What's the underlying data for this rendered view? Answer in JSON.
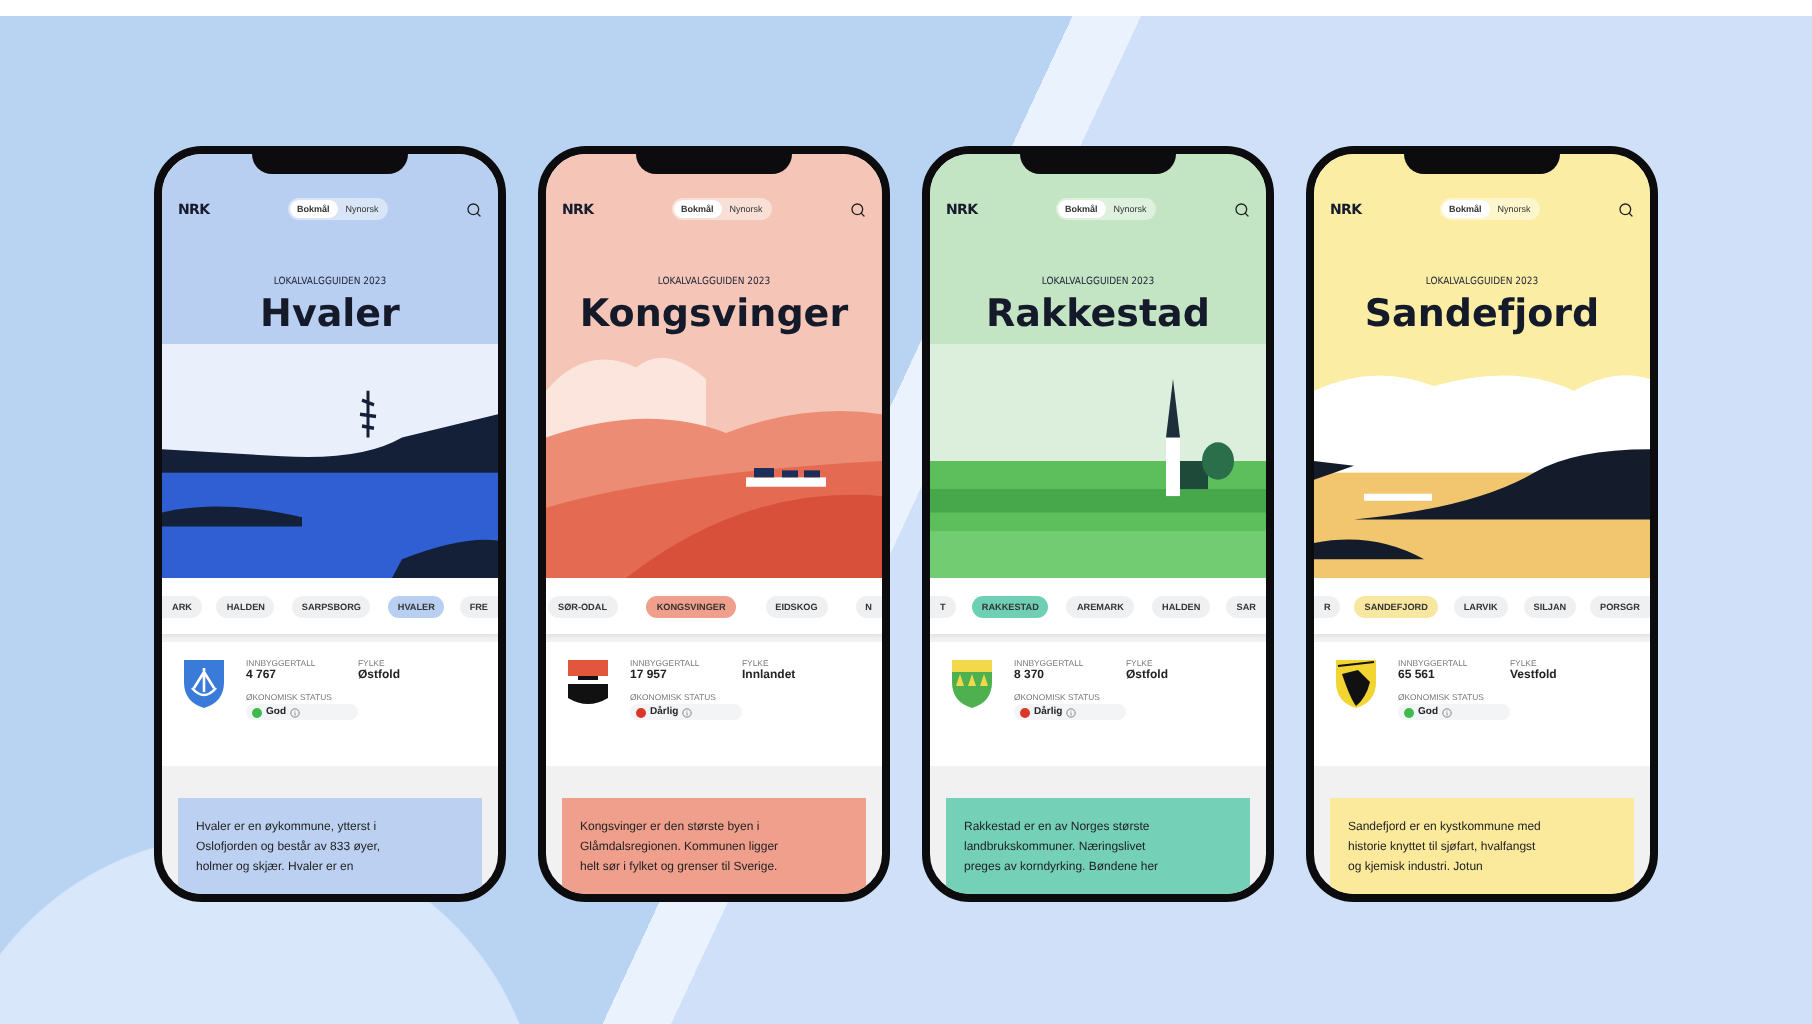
{
  "phones": [
    {
      "kind": "sea",
      "logo": "NRK",
      "languages": [
        {
          "label": "Bokmål",
          "selected": true
        },
        {
          "label": "Nynorsk",
          "selected": false
        }
      ],
      "kicker": "LOKALVALGGUIDEN 2023",
      "title": "Hvaler",
      "chips": [
        {
          "label": "ARK",
          "selected": false,
          "kind": "cutleft"
        },
        {
          "label": "HALDEN",
          "selected": false,
          "kind": "whole"
        },
        {
          "label": "SARPSBORG",
          "selected": false,
          "kind": "whole"
        },
        {
          "label": "HVALER",
          "selected": true,
          "kind": "whole"
        },
        {
          "label": "FRE",
          "selected": false,
          "kind": "cutright"
        }
      ],
      "stats": {
        "population_label": "INNBYGGERTALL",
        "population": "4 767",
        "county_label": "FYLKE",
        "county": "Østfold",
        "status_label": "ØKONOMISK STATUS",
        "status": {
          "label": "God",
          "color": "#3dbb4f"
        }
      },
      "description": "Hvaler er en øykommune, ytterst i\nOslofjorden og består av 833 øyer,\nholmer og skjær. Hvaler er en"
    },
    {
      "kind": "hills",
      "logo": "NRK",
      "languages": [
        {
          "label": "Bokmål",
          "selected": true
        },
        {
          "label": "Nynorsk",
          "selected": false
        }
      ],
      "kicker": "LOKALVALGGUIDEN 2023",
      "title": "Kongsvinger",
      "chips": [
        {
          "label": "SØR-ODAL",
          "selected": false,
          "kind": "whole"
        },
        {
          "label": "KONGSVINGER",
          "selected": true,
          "kind": "whole"
        },
        {
          "label": "EIDSKOG",
          "selected": false,
          "kind": "whole"
        },
        {
          "label": "N",
          "selected": false,
          "kind": "cutright"
        }
      ],
      "stats": {
        "population_label": "INNBYGGERTALL",
        "population": "17 957",
        "county_label": "FYLKE",
        "county": "Innlandet",
        "status_label": "ØKONOMISK STATUS",
        "status": {
          "label": "Dårlig",
          "color": "#d9382b"
        }
      },
      "description": "Kongsvinger er den største byen i\nGlåmdalsregionen. Kommunen ligger\nhelt sør i fylket og grenser til Sverige."
    },
    {
      "kind": "fields",
      "logo": "NRK",
      "languages": [
        {
          "label": "Bokmål",
          "selected": true
        },
        {
          "label": "Nynorsk",
          "selected": false
        }
      ],
      "kicker": "LOKALVALGGUIDEN 2023",
      "title": "Rakkestad",
      "chips": [
        {
          "label": "T",
          "selected": false,
          "kind": "cutleft"
        },
        {
          "label": "RAKKESTAD",
          "selected": true,
          "kind": "whole"
        },
        {
          "label": "AREMARK",
          "selected": false,
          "kind": "whole"
        },
        {
          "label": "HALDEN",
          "selected": false,
          "kind": "whole"
        },
        {
          "label": "SAR",
          "selected": false,
          "kind": "cutright"
        }
      ],
      "stats": {
        "population_label": "INNBYGGERTALL",
        "population": "8 370",
        "county_label": "FYLKE",
        "county": "Østfold",
        "status_label": "ØKONOMISK STATUS",
        "status": {
          "label": "Dårlig",
          "color": "#d9382b"
        }
      },
      "description": "Rakkestad er en av Norges største\nlandbrukskommuner. Næringslivet\npreges av korndyrking. Bøndene her"
    },
    {
      "kind": "coast",
      "logo": "NRK",
      "languages": [
        {
          "label": "Bokmål",
          "selected": true
        },
        {
          "label": "Nynorsk",
          "selected": false
        }
      ],
      "kicker": "LOKALVALGGUIDEN 2023",
      "title": "Sandefjord",
      "chips": [
        {
          "label": "R",
          "selected": false,
          "kind": "cutleft"
        },
        {
          "label": "SANDEFJORD",
          "selected": true,
          "kind": "whole"
        },
        {
          "label": "LARVIK",
          "selected": false,
          "kind": "whole"
        },
        {
          "label": "SILJAN",
          "selected": false,
          "kind": "whole"
        },
        {
          "label": "PORSGR",
          "selected": false,
          "kind": "cutright"
        }
      ],
      "stats": {
        "population_label": "INNBYGGERTALL",
        "population": "65 561",
        "county_label": "FYLKE",
        "county": "Vestfold",
        "status_label": "ØKONOMISK STATUS",
        "status": {
          "label": "God",
          "color": "#3dbb4f"
        }
      },
      "description": "Sandefjord er en kystkommune med\nhistorie knyttet til sjøfart, hvalfangst\nog kjemisk industri. Jotun"
    }
  ]
}
